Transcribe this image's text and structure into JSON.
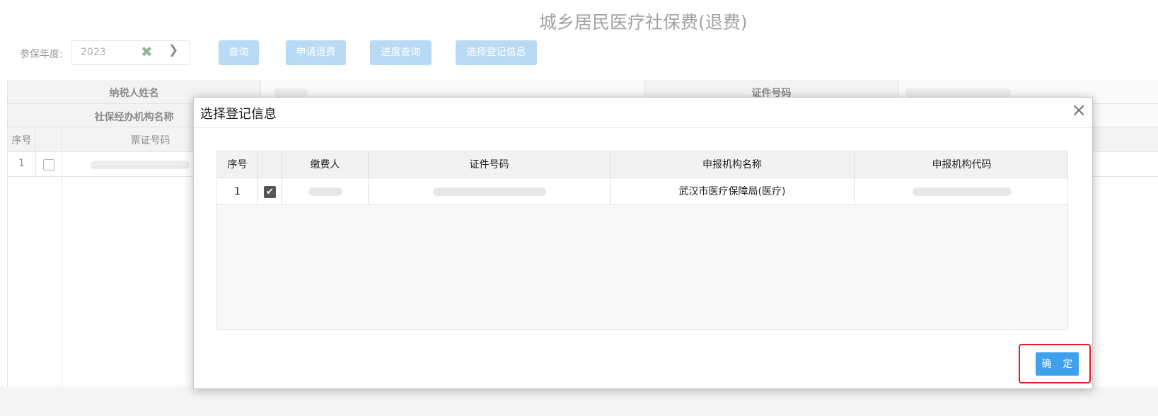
{
  "page": {
    "title": "城乡居民医疗社保费(退费)",
    "filter": {
      "year_label": "参保年度:",
      "year_value": "2023"
    },
    "buttons": {
      "query": "查询",
      "apply_refund": "申请退费",
      "progress_query": "进度查询",
      "select_registration": "选择登记信息"
    },
    "info_table": {
      "taxpayer_name_label": "纳税人姓名",
      "id_number_label": "证件号码",
      "agency_name_label": "社保经办机构名称"
    },
    "list_table": {
      "headers": {
        "index": "序号",
        "ticket_number": "票证号码"
      },
      "rows": [
        {
          "index": "1"
        }
      ]
    }
  },
  "modal": {
    "title": "选择登记信息",
    "columns": {
      "index": "序号",
      "payer": "缴费人",
      "id_number": "证件号码",
      "agency_name": "申报机构名称",
      "agency_code": "申报机构代码"
    },
    "rows": [
      {
        "index": "1",
        "checked": true,
        "agency_name": "武汉市医疗保障局(医疗)"
      }
    ],
    "confirm_label": "确 定"
  },
  "colors": {
    "primary_button": "#3fa1ee",
    "disabled_button": "#b9daf5",
    "highlight": "#e31c1c"
  },
  "icons": {
    "clear": "clear-x-icon",
    "dropdown": "chevron-down-icon",
    "close": "close-icon",
    "checkbox": "check-icon"
  }
}
